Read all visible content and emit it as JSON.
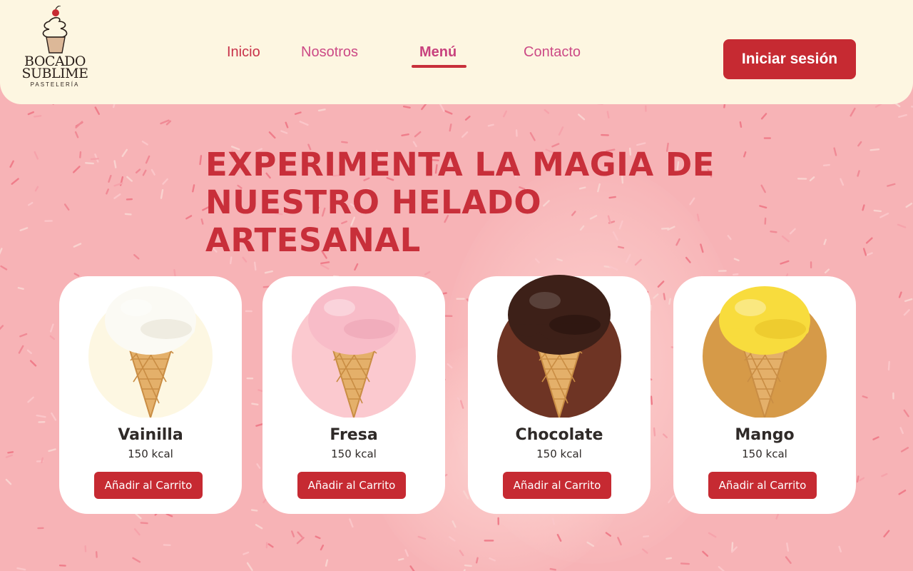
{
  "brand": {
    "line1": "BOCADO",
    "line2": "SUBLIME",
    "sub": "PASTELERÍA"
  },
  "nav": {
    "items": [
      {
        "label": "Inicio"
      },
      {
        "label": "Nosotros"
      },
      {
        "label": "Menú",
        "active": true
      },
      {
        "label": "Contacto"
      }
    ]
  },
  "auth": {
    "login_label": "Iniciar sesión"
  },
  "hero": {
    "line1": "EXPERIMENTA LA MAGIA DE",
    "line2": "NUESTRO HELADO ARTESANAL"
  },
  "products": [
    {
      "name": "Vainilla",
      "kcal": "150 kcal",
      "button": "Añadir al Carrito",
      "circle_color": "#fdf7e2",
      "scoop_color": "#fbfaf4",
      "scoop_shade": "#e9e6d9",
      "icon": "vanilla-cone-icon"
    },
    {
      "name": "Fresa",
      "kcal": "150 kcal",
      "button": "Añadir al Carrito",
      "circle_color": "#fbc9cf",
      "scoop_color": "#f8bcc8",
      "scoop_shade": "#eea6b6",
      "icon": "strawberry-cone-icon"
    },
    {
      "name": "Chocolate",
      "kcal": "150 kcal",
      "button": "Añadir al Carrito",
      "circle_color": "#6e3424",
      "scoop_color": "#3d2018",
      "scoop_shade": "#2a140e",
      "icon": "chocolate-cone-icon"
    },
    {
      "name": "Mango",
      "kcal": "150 kcal",
      "button": "Añadir al Carrito",
      "circle_color": "#d69a48",
      "scoop_color": "#f8dc3d",
      "scoop_shade": "#e9c52a",
      "icon": "mango-cone-icon"
    }
  ],
  "colors": {
    "accent": "#c62a32",
    "header_bg": "#fdf6e1",
    "page_bg": "#f7b3b6",
    "nav_text": "#cc4a86",
    "title": "#c82f3a"
  }
}
